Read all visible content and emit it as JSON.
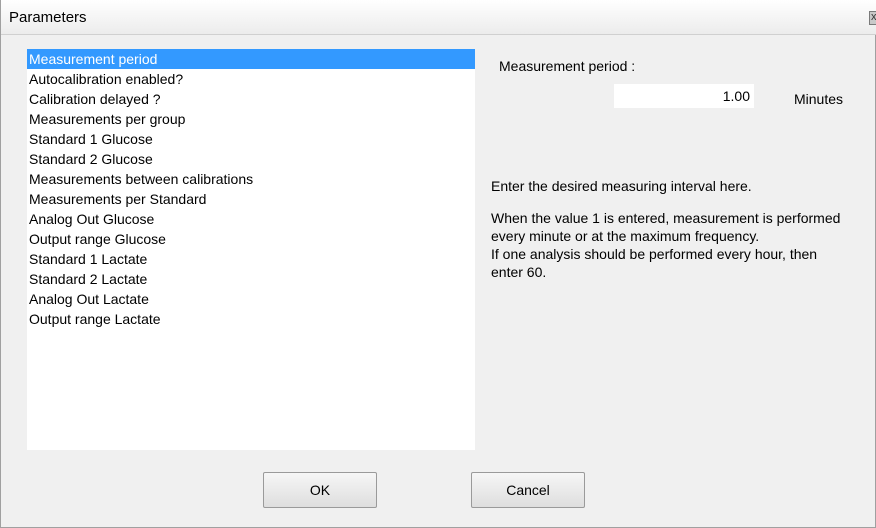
{
  "window": {
    "title": "Parameters",
    "close_glyph": "x"
  },
  "parameters_list": {
    "items": [
      "Measurement period",
      "Autocalibration enabled?",
      "Calibration delayed ?",
      "Measurements per group",
      "Standard 1 Glucose",
      "Standard 2 Glucose",
      "Measurements between calibrations",
      "Measurements per Standard",
      "Analog Out Glucose",
      "Output range Glucose",
      "Standard 1 Lactate",
      "Standard 2 Lactate",
      "Analog Out Lactate",
      "Output range Lactate"
    ],
    "selected_index": 0
  },
  "detail": {
    "label": "Measurement period :",
    "value": "1.00",
    "unit": "Minutes",
    "help_line1": "Enter the desired measuring interval here.",
    "help_line2": "When the value 1 is entered, measurement is performed every minute or at the maximum frequency.",
    "help_line3": "If one analysis should be performed every hour, then enter 60."
  },
  "buttons": {
    "ok": "OK",
    "cancel": "Cancel"
  },
  "colors": {
    "selection": "#3399ff",
    "window_bg": "#f0f0f0"
  }
}
